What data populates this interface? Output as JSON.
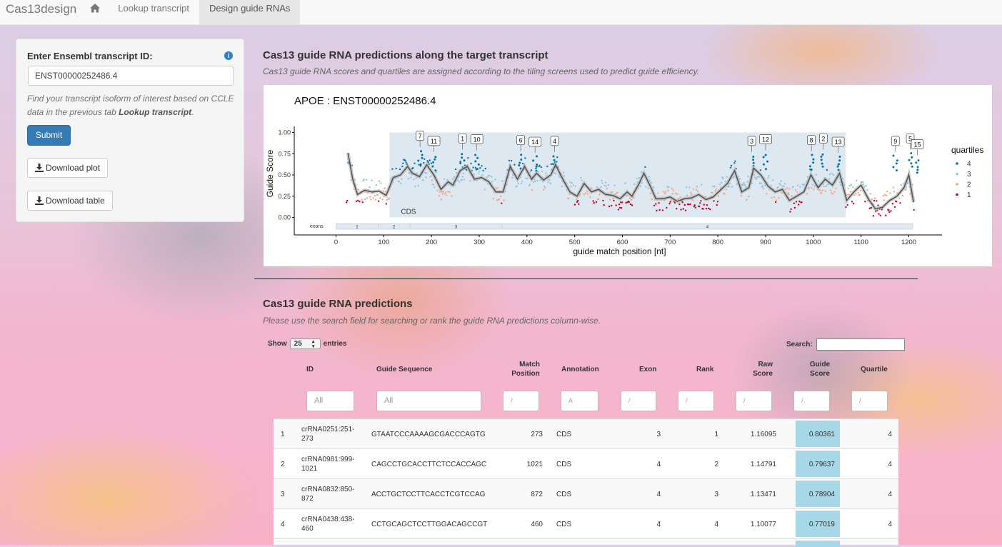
{
  "navbar": {
    "brand": "Cas13design",
    "tabs": [
      "Lookup transcript",
      "Design guide RNAs"
    ],
    "active_tab": "Design guide RNAs"
  },
  "sidebar": {
    "input_label": "Enter Ensembl transcript ID:",
    "transcript_id": "ENST00000252486.4",
    "help_text_prefix": "Find your transcript isoform of interest based on CCLE data in the previous tab ",
    "help_text_bold": "Lookup transcript",
    "help_text_suffix": ".",
    "submit_label": "Submit",
    "download_plot_label": "Download plot",
    "download_table_label": "Download table"
  },
  "plot_section": {
    "title": "Cas13 guide RNA predictions along the target transcript",
    "subtitle": "Cas13 guide RNA scores and quartiles are assigned according to the tiling screens used to predict guide efficiency."
  },
  "chart_data": {
    "type": "scatter",
    "title": "APOE : ENST00000252486.4",
    "xlabel": "guide match position [nt]",
    "ylabel": "Guide Score",
    "xlim": [
      -40,
      1270
    ],
    "ylim": [
      -0.2,
      1.1
    ],
    "xticks": [
      0,
      100,
      200,
      300,
      400,
      500,
      600,
      700,
      800,
      900,
      1000,
      1100,
      1200
    ],
    "yticks": [
      0.0,
      0.25,
      0.5,
      0.75,
      1.0
    ],
    "ytick_labels": [
      "0.00",
      "0.25",
      "0.50",
      "0.75",
      "1.00"
    ],
    "cds": {
      "start": 112,
      "end": 1068,
      "label": "CDS"
    },
    "exons": {
      "label": "exons",
      "segments": [
        {
          "name": "1",
          "start": 0,
          "end": 88
        },
        {
          "name": "2",
          "start": 88,
          "end": 155
        },
        {
          "name": "3",
          "start": 155,
          "end": 348
        },
        {
          "name": "4",
          "start": 348,
          "end": 1208
        }
      ]
    },
    "legend": {
      "title": "quartiles",
      "position": "right",
      "entries": [
        {
          "label": "4",
          "color": "#0571b0"
        },
        {
          "label": "3",
          "color": "#92c5de"
        },
        {
          "label": "2",
          "color": "#f4a582"
        },
        {
          "label": "1",
          "color": "#ca0020"
        }
      ]
    },
    "smooth_line": {
      "color": "#555555",
      "points": [
        [
          25,
          0.76
        ],
        [
          35,
          0.45
        ],
        [
          45,
          0.27
        ],
        [
          60,
          0.32
        ],
        [
          75,
          0.3
        ],
        [
          90,
          0.31
        ],
        [
          105,
          0.26
        ],
        [
          120,
          0.47
        ],
        [
          135,
          0.5
        ],
        [
          150,
          0.6
        ],
        [
          160,
          0.52
        ],
        [
          175,
          0.48
        ],
        [
          190,
          0.62
        ],
        [
          205,
          0.5
        ],
        [
          220,
          0.33
        ],
        [
          235,
          0.42
        ],
        [
          245,
          0.38
        ],
        [
          260,
          0.55
        ],
        [
          275,
          0.6
        ],
        [
          290,
          0.45
        ],
        [
          305,
          0.47
        ],
        [
          320,
          0.42
        ],
        [
          335,
          0.3
        ],
        [
          350,
          0.3
        ],
        [
          365,
          0.6
        ],
        [
          380,
          0.45
        ],
        [
          395,
          0.6
        ],
        [
          410,
          0.45
        ],
        [
          420,
          0.52
        ],
        [
          435,
          0.44
        ],
        [
          450,
          0.5
        ],
        [
          460,
          0.62
        ],
        [
          475,
          0.45
        ],
        [
          490,
          0.3
        ],
        [
          505,
          0.25
        ],
        [
          520,
          0.4
        ],
        [
          535,
          0.3
        ],
        [
          550,
          0.33
        ],
        [
          565,
          0.27
        ],
        [
          580,
          0.26
        ],
        [
          595,
          0.22
        ],
        [
          610,
          0.3
        ],
        [
          620,
          0.25
        ],
        [
          635,
          0.4
        ],
        [
          645,
          0.52
        ],
        [
          660,
          0.35
        ],
        [
          670,
          0.22
        ],
        [
          685,
          0.22
        ],
        [
          700,
          0.24
        ],
        [
          715,
          0.19
        ],
        [
          730,
          0.22
        ],
        [
          745,
          0.23
        ],
        [
          760,
          0.27
        ],
        [
          775,
          0.21
        ],
        [
          790,
          0.24
        ],
        [
          805,
          0.32
        ],
        [
          820,
          0.4
        ],
        [
          835,
          0.55
        ],
        [
          850,
          0.3
        ],
        [
          865,
          0.35
        ],
        [
          875,
          0.58
        ],
        [
          890,
          0.5
        ],
        [
          905,
          0.37
        ],
        [
          920,
          0.3
        ],
        [
          935,
          0.33
        ],
        [
          950,
          0.2
        ],
        [
          965,
          0.25
        ],
        [
          980,
          0.3
        ],
        [
          995,
          0.5
        ],
        [
          1010,
          0.35
        ],
        [
          1025,
          0.45
        ],
        [
          1040,
          0.38
        ],
        [
          1055,
          0.52
        ],
        [
          1070,
          0.2
        ],
        [
          1085,
          0.3
        ],
        [
          1100,
          0.38
        ],
        [
          1115,
          0.22
        ],
        [
          1130,
          0.1
        ],
        [
          1145,
          0.12
        ],
        [
          1160,
          0.2
        ],
        [
          1175,
          0.25
        ],
        [
          1190,
          0.35
        ],
        [
          1200,
          0.5
        ],
        [
          1210,
          0.18
        ]
      ]
    },
    "labels": [
      {
        "id": "7",
        "x": 176,
        "y": 0.83
      },
      {
        "id": "11",
        "x": 205,
        "y": 0.77
      },
      {
        "id": "1",
        "x": 265,
        "y": 0.8
      },
      {
        "id": "10",
        "x": 295,
        "y": 0.79
      },
      {
        "id": "6",
        "x": 387,
        "y": 0.78
      },
      {
        "id": "14",
        "x": 417,
        "y": 0.76
      },
      {
        "id": "4",
        "x": 458,
        "y": 0.77
      },
      {
        "id": "3",
        "x": 871,
        "y": 0.77
      },
      {
        "id": "12",
        "x": 900,
        "y": 0.79
      },
      {
        "id": "8",
        "x": 996,
        "y": 0.78
      },
      {
        "id": "2",
        "x": 1021,
        "y": 0.8
      },
      {
        "id": "13",
        "x": 1052,
        "y": 0.76
      },
      {
        "id": "9",
        "x": 1172,
        "y": 0.77
      },
      {
        "id": "5",
        "x": 1203,
        "y": 0.8
      },
      {
        "id": "15",
        "x": 1218,
        "y": 0.73
      }
    ]
  },
  "table_section": {
    "title": "Cas13 guide RNA predictions",
    "subtitle": "Please use the search field for searching or rank the guide RNA predictions column-wise.",
    "show_label": "Show",
    "entries_value": "25",
    "entries_label": "entries",
    "search_label": "Search:",
    "columns": [
      "ID",
      "Guide Sequence",
      "Match Position",
      "Annotation",
      "Exon",
      "Rank",
      "Raw Score",
      "Guide Score",
      "Quartile"
    ],
    "columns_line1": [
      "ID",
      "Guide Sequence",
      "Match",
      "Annotation",
      "Exon",
      "Rank",
      "Raw",
      "Guide",
      "Quartile"
    ],
    "columns_line2": [
      "",
      "",
      "Position",
      "",
      "",
      "",
      "Score",
      "Score",
      ""
    ],
    "filter_placeholders": [
      "All",
      "All",
      "/",
      "A",
      "/",
      "/",
      "/",
      "/",
      "/"
    ],
    "rows": [
      {
        "n": "1",
        "id1": "crRNA0251:251-",
        "id2": "273",
        "seq": "GTAATCCCAAAAGCGACCCAGTG",
        "pos": "273",
        "ann": "CDS",
        "exon": "3",
        "rank": "1",
        "raw": "1.16095",
        "score": "0.80361",
        "quartile": "4"
      },
      {
        "n": "2",
        "id1": "crRNA0981:999-",
        "id2": "1021",
        "seq": "CAGCCTGCACCTTCTCCACCAGC",
        "pos": "1021",
        "ann": "CDS",
        "exon": "4",
        "rank": "2",
        "raw": "1.14791",
        "score": "0.79637",
        "quartile": "4"
      },
      {
        "n": "3",
        "id1": "crRNA0832:850-",
        "id2": "872",
        "seq": "ACCTGCTCCTTCACCTCGTCCAG",
        "pos": "872",
        "ann": "CDS",
        "exon": "4",
        "rank": "3",
        "raw": "1.13471",
        "score": "0.78904",
        "quartile": "4"
      },
      {
        "n": "4",
        "id1": "crRNA0438:438-",
        "id2": "460",
        "seq": "CCTGCAGCTCCTTGGACAGCCGT",
        "pos": "460",
        "ann": "CDS",
        "exon": "4",
        "rank": "4",
        "raw": "1.10077",
        "score": "0.77019",
        "quartile": "4"
      }
    ],
    "score_highlight_color": "#a6d8e8"
  }
}
